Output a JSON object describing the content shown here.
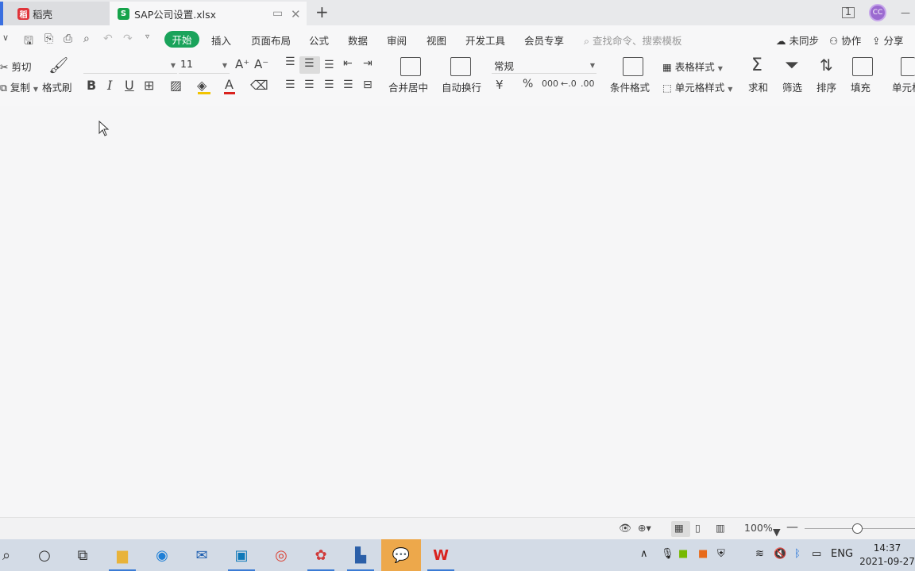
{
  "tabs": [
    {
      "label": "稻壳",
      "icon": "docer-icon"
    },
    {
      "label": "SAP公司设置.xlsx",
      "icon": "spreadsheet-icon"
    }
  ],
  "window": {
    "account": "CC"
  },
  "menu": {
    "items": [
      "开始",
      "插入",
      "页面布局",
      "公式",
      "数据",
      "审阅",
      "视图",
      "开发工具",
      "会员专享"
    ],
    "active": "开始",
    "search_placeholder": "查找命令、搜索模板",
    "sync": "未同步",
    "collab": "协作",
    "share": "分享"
  },
  "ribbon": {
    "cut": "剪切",
    "copy": "复制",
    "format_painter": "格式刷",
    "font_name": "",
    "font_size": "11",
    "merge_center": "合并居中",
    "wrap_text": "自动换行",
    "number_format": "常规",
    "conditional_format": "条件格式",
    "table_style": "表格样式",
    "cell_style": "单元格样式",
    "sum": "求和",
    "filter": "筛选",
    "sort": "排序",
    "fill": "填充",
    "cell": "单元格",
    "font_color": "#d9221e",
    "highlight_color": "#f2c400"
  },
  "status": {
    "zoom": "100%"
  },
  "taskbar": {
    "tray_lang": "ENG",
    "time": "14:37",
    "date": "2021-09-27"
  }
}
